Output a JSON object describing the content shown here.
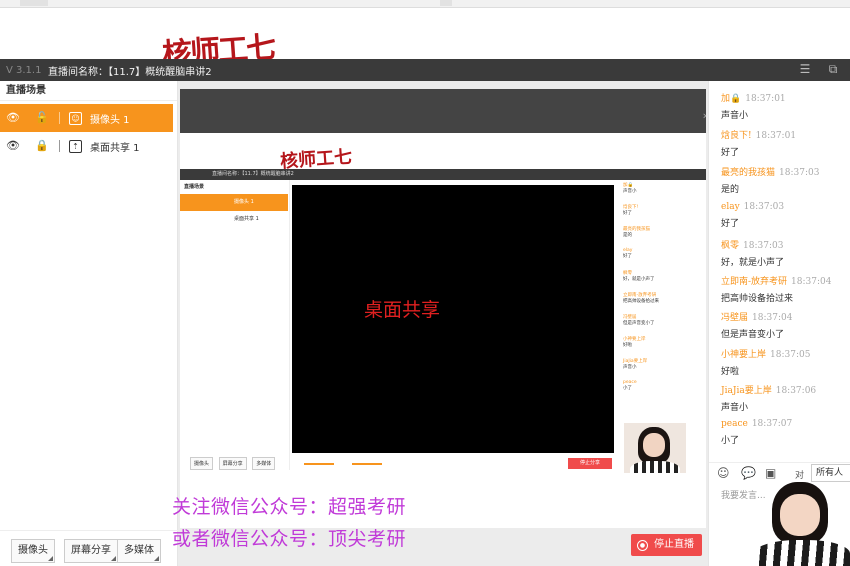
{
  "handwriting": "核师工七",
  "titlebar": {
    "version": "V 3.1.1",
    "room_title": "直播间名称：【11.7】概统醒脑串讲2"
  },
  "scenes": {
    "header": "直播场景",
    "items": [
      {
        "label": "摄像头 1",
        "active": true
      },
      {
        "label": "桌面共享 1",
        "active": false
      }
    ]
  },
  "left_buttons": [
    "摄像头",
    "屏幕分享",
    "多媒体"
  ],
  "stage": {
    "share_label": "桌面共享",
    "stop_share": "停止分享",
    "nested_buttons": [
      "摄像头",
      "屏幕分享",
      "多媒体"
    ],
    "nested_scenes": [
      "摄像头 1",
      "桌面共享 1"
    ]
  },
  "promo": {
    "line1": "关注微信公众号：超强考研",
    "line2": "或者微信公众号：顶尖考研"
  },
  "chat": {
    "messages": [
      {
        "name": "加🔒",
        "time": "18:37:01",
        "text": "声音小"
      },
      {
        "name": "焓良下!",
        "time": "18:37:01",
        "text": "好了"
      },
      {
        "name": "最亮的我孩猫",
        "time": "18:37:03",
        "text": "是的"
      },
      {
        "name": "elay",
        "time": "18:37:03",
        "text": "好了"
      },
      {
        "name": "枫零",
        "time": "18:37:03",
        "text": "好，就是小声了"
      },
      {
        "name": "立即南-放弃考研",
        "time": "18:37:04",
        "text": "把高帅设备拾过来"
      },
      {
        "name": "冯壁届",
        "time": "18:37:04",
        "text": "但是声音变小了"
      },
      {
        "name": "小神要上岸",
        "time": "18:37:05",
        "text": "好啦"
      },
      {
        "name": "JiaJia要上岸",
        "time": "18:37:06",
        "text": "声音小"
      },
      {
        "name": "peace",
        "time": "18:37:07",
        "text": "小了"
      }
    ],
    "to_label": "对",
    "recipient": "所有人",
    "input_placeholder": "我要发言...",
    "stop_live": "停止直播"
  },
  "colors": {
    "accent": "#f7941d",
    "danger": "#f04b4b",
    "titlebar": "#3a3a3a",
    "promo": "#c03ad8"
  }
}
